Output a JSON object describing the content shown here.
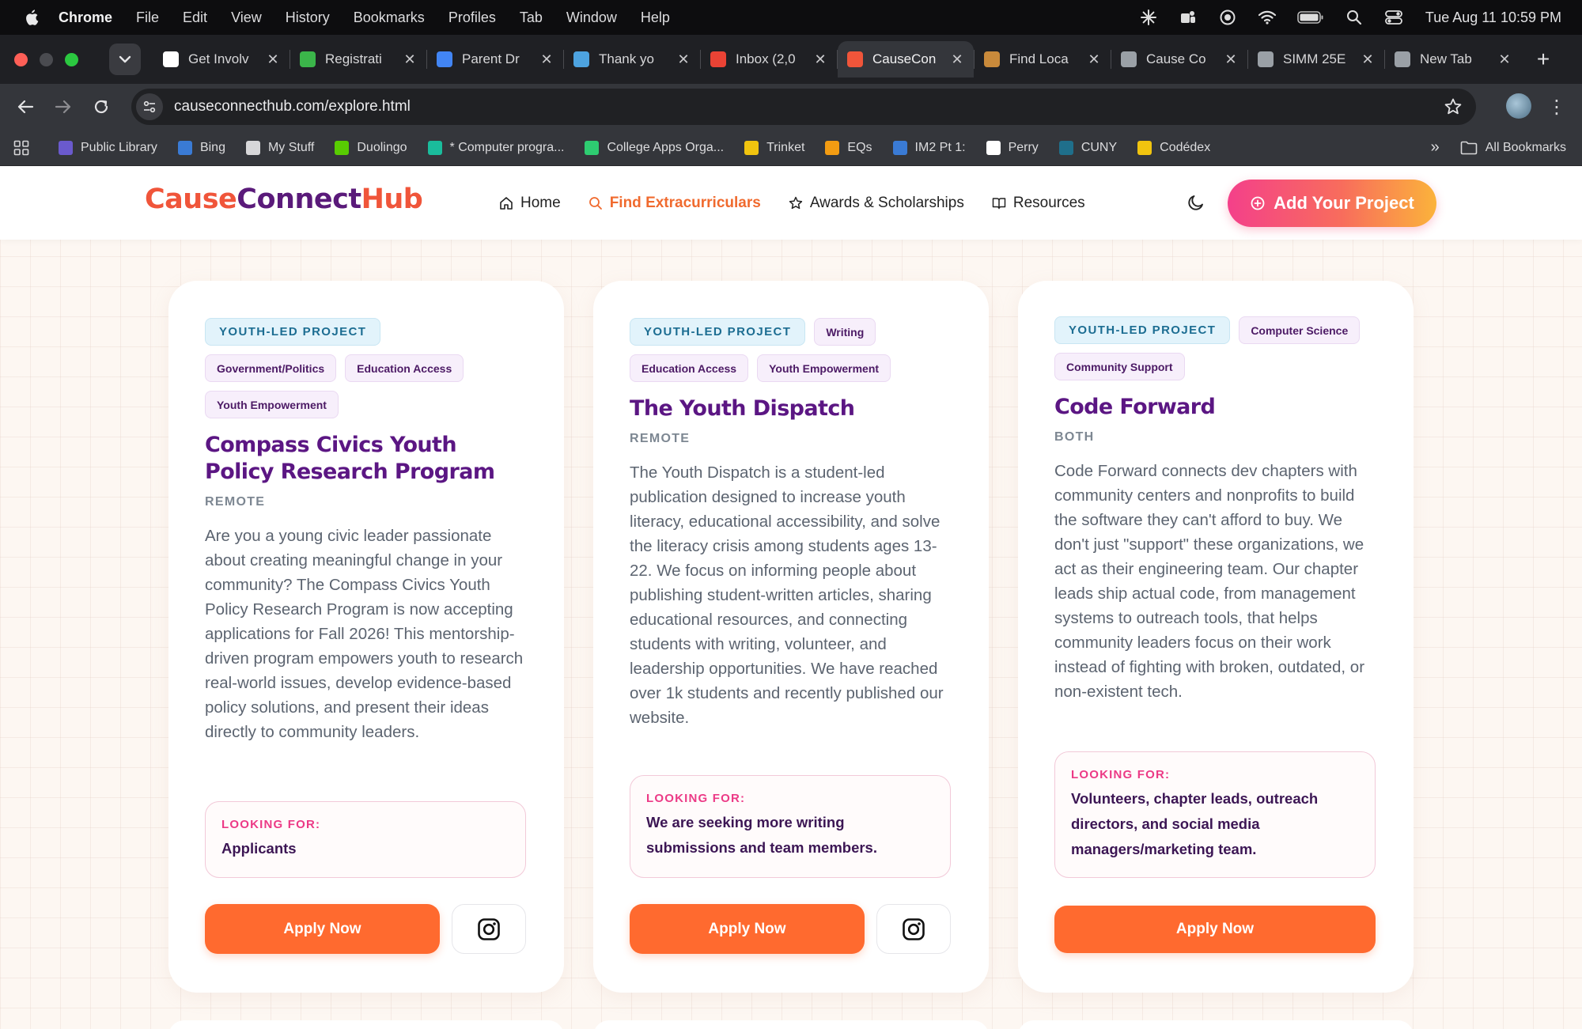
{
  "menubar": {
    "app": "Chrome",
    "items": [
      "File",
      "Edit",
      "View",
      "History",
      "Bookmarks",
      "Profiles",
      "Tab",
      "Window",
      "Help"
    ],
    "clock": "Tue Aug 11  10:59 PM"
  },
  "tabs": [
    {
      "title": "Get Involv",
      "fav_color": "#ffffff"
    },
    {
      "title": "Registrati",
      "fav_color": "#3bb54a"
    },
    {
      "title": "Parent Dr",
      "fav_color": "#4285f4"
    },
    {
      "title": "Thank yo",
      "fav_color": "#4da3e0"
    },
    {
      "title": "Inbox (2,0",
      "fav_color": "#ea4335"
    },
    {
      "title": "CauseCon",
      "fav_color": "#f0553a",
      "active": true
    },
    {
      "title": "Find Loca",
      "fav_color": "#c98a3b"
    },
    {
      "title": "Cause Co",
      "fav_color": "#9aa0a6"
    },
    {
      "title": "SIMM 25E",
      "fav_color": "#9aa0a6"
    },
    {
      "title": "New Tab",
      "fav_color": "#9aa0a6"
    }
  ],
  "toolbar": {
    "url": "causeconnecthub.com/explore.html"
  },
  "bookmarks": [
    {
      "label": "Public Library",
      "color": "#6a5acd"
    },
    {
      "label": "Bing",
      "color": "#3a7bd5"
    },
    {
      "label": "My Stuff",
      "color": "#d7d7d9"
    },
    {
      "label": "Duolingo",
      "color": "#58cc02"
    },
    {
      "label": "* Computer progra...",
      "color": "#1abc9c"
    },
    {
      "label": "College Apps Orga...",
      "color": "#2ecc71"
    },
    {
      "label": "Trinket",
      "color": "#f1c40f"
    },
    {
      "label": "EQs",
      "color": "#f39c12"
    },
    {
      "label": "IM2 Pt 1:",
      "color": "#3a7bd5"
    },
    {
      "label": "Perry",
      "color": "#ffffff"
    },
    {
      "label": "CUNY",
      "color": "#1f6f8b"
    },
    {
      "label": "Codédex",
      "color": "#f1c40f"
    }
  ],
  "bookmarks_right": {
    "label": "All Bookmarks"
  },
  "site": {
    "logo_cause": "Cause",
    "logo_connect": "Connect",
    "logo_hub": "Hub",
    "nav": {
      "home": "Home",
      "find": "Find Extracurriculars",
      "awards": "Awards & Scholarships",
      "resources": "Resources"
    },
    "add_project": "Add Your Project",
    "accent": "#f06a2e"
  },
  "cards": [
    {
      "tags": [
        "YOUTH-LED PROJECT",
        "Government/Politics",
        "Education Access",
        "Youth Empowerment"
      ],
      "title": "Compass Civics Youth Policy Research Program",
      "location": "REMOTE",
      "description": "Are you a young civic leader passionate about creating meaningful change in your community? The Compass Civics Youth Policy Research Program is now accepting applications for Fall 2026! This mentorship-driven program empowers youth to research real-world issues, develop evidence-based policy solutions, and present their ideas directly to community leaders.",
      "looking_label": "LOOKING FOR:",
      "looking_value": "Applicants",
      "apply": "Apply Now"
    },
    {
      "tags": [
        "YOUTH-LED PROJECT",
        "Writing",
        "Education Access",
        "Youth Empowerment"
      ],
      "title": "The Youth Dispatch",
      "location": "REMOTE",
      "description": "The Youth Dispatch is a student-led publication designed to increase youth literacy, educational accessibility, and solve the literacy crisis among students ages 13-22. We focus on informing people about publishing student-written articles, sharing educational resources, and connecting students with writing, volunteer, and leadership opportunities. We have reached over 1k students and recently published our website.",
      "looking_label": "LOOKING FOR:",
      "looking_value": "We are seeking more writing submissions and team members.",
      "apply": "Apply Now"
    },
    {
      "tags": [
        "YOUTH-LED PROJECT",
        "Computer Science",
        "Community Support"
      ],
      "title": "Code Forward",
      "location": "BOTH",
      "description": "Code Forward connects dev chapters with community centers and nonprofits to build the software they can't afford to buy. We don't just \"support\" these organizations, we act as their engineering team. Our chapter leads ship actual code, from management systems to outreach tools, that helps community leaders focus on their work instead of fighting with broken, outdated, or non-existent tech.",
      "looking_label": "LOOKING FOR:",
      "looking_value": "Volunteers, chapter leads, outreach directors, and social media managers/marketing team.",
      "apply": "Apply Now"
    }
  ]
}
